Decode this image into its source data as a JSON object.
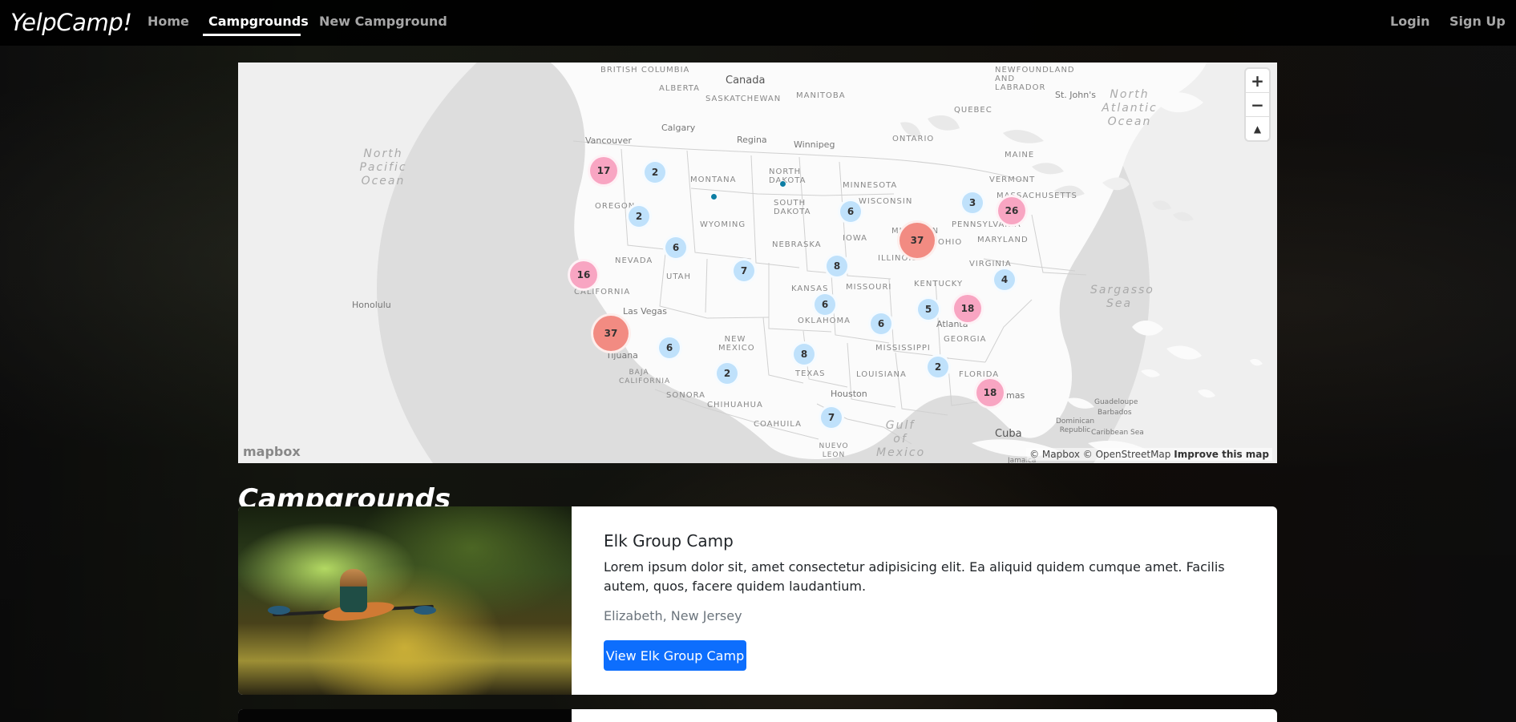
{
  "navbar": {
    "brand": "YelpCamp!",
    "links": [
      "Home",
      "Campgrounds",
      "New Campground"
    ],
    "auth": [
      "Login",
      "Sign Up"
    ]
  },
  "map": {
    "controls": {
      "zoom_in": "+",
      "zoom_out": "−",
      "reset_north": "▲"
    },
    "logo": "mapbox",
    "attribution": "© Mapbox © OpenStreetMap",
    "improve": "Improve this map",
    "labels": [
      {
        "text": "BRITISH COLUMBIA"
      },
      {
        "text": "Canada"
      },
      {
        "text": "ALBERTA"
      },
      {
        "text": "SASKATCHEWAN"
      },
      {
        "text": "MANITOBA"
      },
      {
        "text": "Calgary"
      },
      {
        "text": "Regina"
      },
      {
        "text": "Winnipeg"
      },
      {
        "text": "ONTARIO"
      },
      {
        "text": "QUEBEC"
      },
      {
        "text": "NEWFOUNDLAND AND LABRADOR"
      },
      {
        "text": "St. John's"
      },
      {
        "text": "North Atlantic Ocean"
      },
      {
        "text": "North Pacific Ocean"
      },
      {
        "text": "Vancouver"
      },
      {
        "text": "MONTANA"
      },
      {
        "text": "NORTH DAKOTA"
      },
      {
        "text": "MINNESOTA"
      },
      {
        "text": "WISCONSIN"
      },
      {
        "text": "MICHIGAN"
      },
      {
        "text": "MAINE"
      },
      {
        "text": "VERMONT"
      },
      {
        "text": "MASSACHUSETTS"
      },
      {
        "text": "OREGON"
      },
      {
        "text": "SOUTH DAKOTA"
      },
      {
        "text": "WYOMING"
      },
      {
        "text": "IOWA"
      },
      {
        "text": "NEBRASKA"
      },
      {
        "text": "PENNSYLVANIA"
      },
      {
        "text": "OHIO"
      },
      {
        "text": "MARYLAND"
      },
      {
        "text": "NEVADA"
      },
      {
        "text": "UTAH"
      },
      {
        "text": "ILLINOIS"
      },
      {
        "text": "VIRGINIA"
      },
      {
        "text": "KANSAS"
      },
      {
        "text": "MISSOURI"
      },
      {
        "text": "KENTUCKY"
      },
      {
        "text": "CALIFORNIA"
      },
      {
        "text": "Las Vegas"
      },
      {
        "text": "OKLAHOMA"
      },
      {
        "text": "Atlanta"
      },
      {
        "text": "NEW MEXICO"
      },
      {
        "text": "GEORGIA"
      },
      {
        "text": "MISSISSIPPI"
      },
      {
        "text": "Tijuana"
      },
      {
        "text": "TEXAS"
      },
      {
        "text": "LOUISIANA"
      },
      {
        "text": "FLORIDA"
      },
      {
        "text": "Honolulu"
      },
      {
        "text": "SONORA"
      },
      {
        "text": "CHIHUAHUA"
      },
      {
        "text": "Houston"
      },
      {
        "text": "Bahamas"
      },
      {
        "text": "COAHUILA"
      },
      {
        "text": "Gulf of Mexico"
      },
      {
        "text": "Cuba"
      },
      {
        "text": "Dominican Republic"
      },
      {
        "text": "Guadeloupe"
      },
      {
        "text": "Barbados"
      },
      {
        "text": "Caribbean Sea"
      },
      {
        "text": "Sargasso Sea"
      },
      {
        "text": "Jamaica"
      },
      {
        "text": "NUEVO LEON"
      },
      {
        "text": "BAJA CALIFORNIA"
      }
    ],
    "clusters": [
      {
        "count": "17",
        "color": "pink"
      },
      {
        "count": "2",
        "color": "blue"
      },
      {
        "count": "2",
        "color": "blue"
      },
      {
        "count": "6",
        "color": "blue"
      },
      {
        "count": "16",
        "color": "pink"
      },
      {
        "count": "7",
        "color": "blue"
      },
      {
        "count": "37",
        "color": "red"
      },
      {
        "count": "6",
        "color": "blue"
      },
      {
        "count": "2",
        "color": "blue"
      },
      {
        "count": "8",
        "color": "blue"
      },
      {
        "count": "6",
        "color": "blue"
      },
      {
        "count": "8",
        "color": "blue"
      },
      {
        "count": "6",
        "color": "blue"
      },
      {
        "count": "7",
        "color": "blue"
      },
      {
        "count": "37",
        "color": "red"
      },
      {
        "count": "6",
        "color": "blue"
      },
      {
        "count": "5",
        "color": "blue"
      },
      {
        "count": "18",
        "color": "pink"
      },
      {
        "count": "3",
        "color": "blue"
      },
      {
        "count": "26",
        "color": "pink"
      },
      {
        "count": "4",
        "color": "blue"
      },
      {
        "count": "2",
        "color": "blue"
      },
      {
        "count": "18",
        "color": "pink"
      }
    ]
  },
  "section_title": "Campgrounds",
  "campground": {
    "title": "Elk Group Camp",
    "description": "Lorem ipsum dolor sit, amet consectetur adipisicing elit. Ea aliquid quidem cumque amet. Facilis autem, quos, facere quidem laudantium.",
    "location": "Elizabeth, New Jersey",
    "button": "View Elk Group Camp"
  }
}
